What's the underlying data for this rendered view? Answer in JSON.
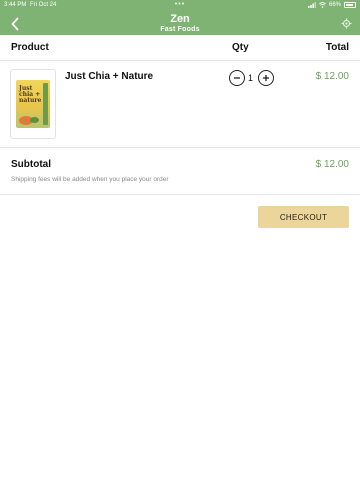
{
  "status_bar": {
    "time": "3:44 PM",
    "date": "Fri Oct 24",
    "battery": "66%"
  },
  "header": {
    "title": "Zen",
    "subtitle": "Fast Foods"
  },
  "table": {
    "col_product": "Product",
    "col_qty": "Qty",
    "col_total": "Total"
  },
  "cart": {
    "items": [
      {
        "name": "Just Chia + Nature",
        "qty": "1",
        "price": "$ 12.00",
        "image_text": "Just chia + nature"
      }
    ]
  },
  "summary": {
    "subtotal_label": "Subtotal",
    "subtotal_value": "$ 12.00",
    "shipping_note": "Shipping fees will be added when you place your order"
  },
  "actions": {
    "checkout_label": "CHECKOUT"
  },
  "colors": {
    "header_green": "#7fb373",
    "price_green": "#6aa35c",
    "checkout_bg": "#ecd59b"
  }
}
